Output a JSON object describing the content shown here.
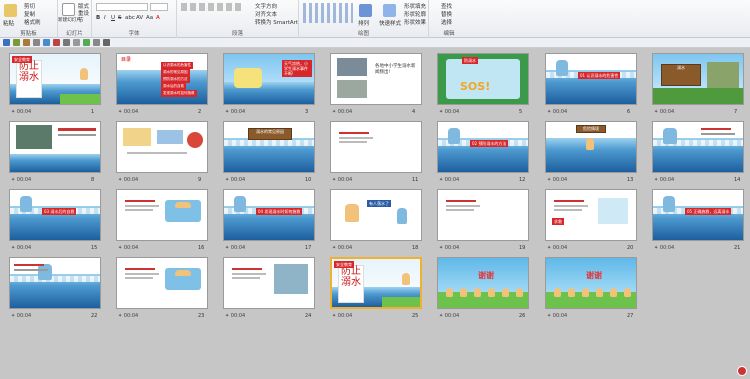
{
  "ribbon": {
    "groups": [
      {
        "label": "剪贴板",
        "items": [
          "粘贴",
          "剪切",
          "复制",
          "格式刷"
        ]
      },
      {
        "label": "幻灯片",
        "items": [
          "新建幻灯片",
          "版式",
          "重设",
          "节"
        ]
      },
      {
        "label": "字体",
        "items": [
          "B",
          "I",
          "U",
          "S",
          "abc",
          "AV",
          "Aa",
          "A"
        ]
      },
      {
        "label": "段落",
        "items": [
          "文字方向",
          "对齐文本",
          "转换为 SmartArt"
        ]
      },
      {
        "label": "绘图",
        "items": [
          "形状",
          "排列",
          "快速样式"
        ]
      },
      {
        "label": "编辑",
        "items": [
          "形状填充",
          "形状轮廓",
          "形状效果",
          "查找",
          "替换",
          "选择"
        ]
      }
    ]
  },
  "slides": [
    {
      "n": "1",
      "time": "00:04",
      "title": "防止溺水",
      "tag": "安全教育"
    },
    {
      "n": "2",
      "time": "00:04",
      "title": "目录",
      "items": [
        "认识溺水的危害性",
        "溺水的常见原因",
        "预防溺水的方法",
        "溺水后的自救",
        "发现溺水时如何施救"
      ]
    },
    {
      "n": "3",
      "time": "00:04",
      "title": "天气凉热，小学生溺水事件不断!"
    },
    {
      "n": "4",
      "time": "00:04",
      "title": "各地中小学生溺水新闻频出!"
    },
    {
      "n": "5",
      "time": "00:04",
      "title": "SOS!",
      "tag": "防溺水"
    },
    {
      "n": "6",
      "time": "00:04",
      "title": "01 认识溺水的危害性"
    },
    {
      "n": "7",
      "time": "00:04",
      "title": "溺水"
    },
    {
      "n": "8",
      "time": "00:04",
      "title": ""
    },
    {
      "n": "9",
      "time": "00:04",
      "title": ""
    },
    {
      "n": "10",
      "time": "00:04",
      "title": "溺水的常见原因"
    },
    {
      "n": "11",
      "time": "00:04",
      "title": ""
    },
    {
      "n": "12",
      "time": "00:04",
      "title": "02 预防溺水的方法"
    },
    {
      "n": "13",
      "time": "00:04",
      "title": "危险情境"
    },
    {
      "n": "14",
      "time": "00:04",
      "title": ""
    },
    {
      "n": "15",
      "time": "00:04",
      "title": "03 溺水后的自救"
    },
    {
      "n": "16",
      "time": "00:04",
      "title": ""
    },
    {
      "n": "17",
      "time": "00:04",
      "title": "04 发现溺水时如何施救"
    },
    {
      "n": "18",
      "time": "00:04",
      "title": "有人落水了"
    },
    {
      "n": "19",
      "time": "00:04",
      "title": ""
    },
    {
      "n": "20",
      "time": "00:04",
      "title": "求救"
    },
    {
      "n": "21",
      "time": "00:04",
      "title": "05 正确施救，远离溺水"
    },
    {
      "n": "22",
      "time": "00:04",
      "title": ""
    },
    {
      "n": "23",
      "time": "00:04",
      "title": ""
    },
    {
      "n": "24",
      "time": "00:04",
      "title": ""
    },
    {
      "n": "25",
      "time": "00:04",
      "title": "防止溺水",
      "tag": "安全教育"
    },
    {
      "n": "26",
      "time": "00:04",
      "title": "谢谢"
    },
    {
      "n": "27",
      "time": "00:04",
      "title": "谢谢"
    }
  ],
  "colors": {
    "accent": "#d7272a",
    "selected": "#f0b030",
    "sea": "#1d5f9e"
  }
}
